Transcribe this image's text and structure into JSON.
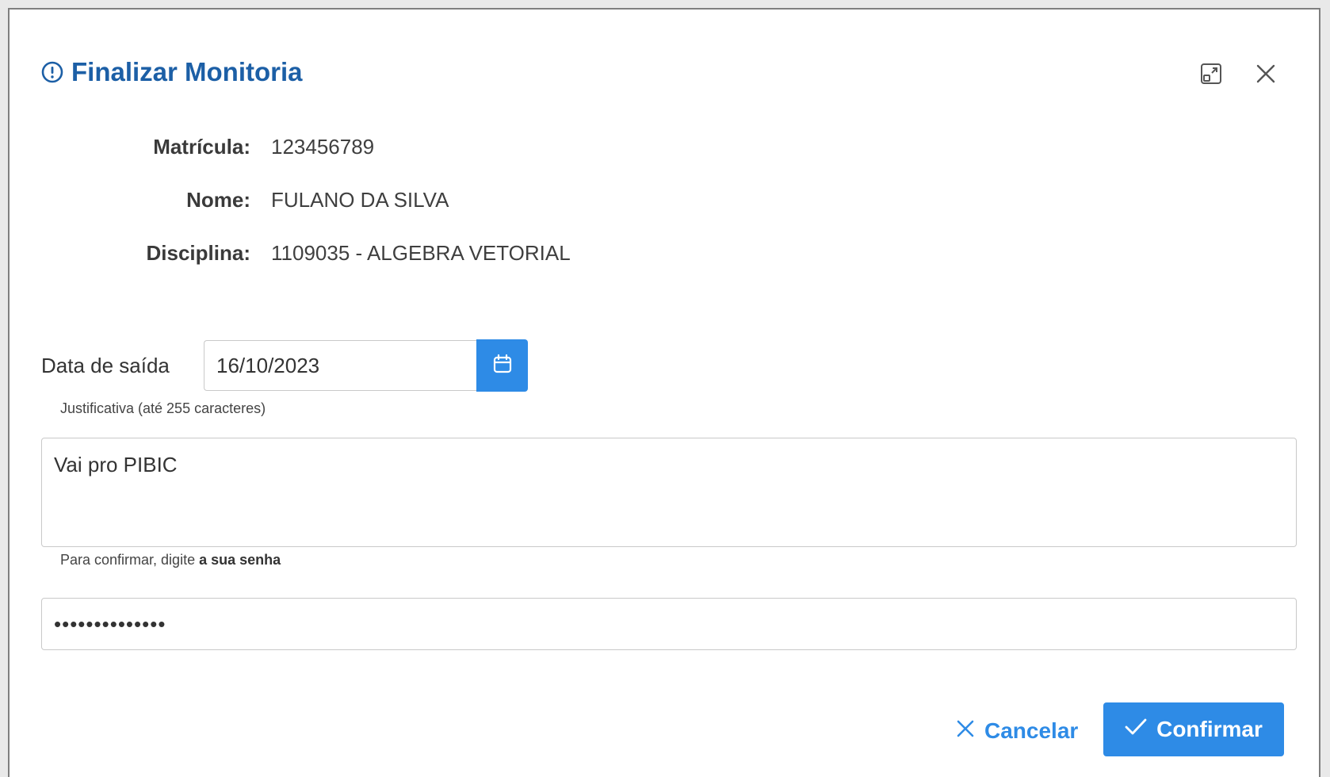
{
  "dialog": {
    "title": "Finalizar Monitoria",
    "title_icon": "exclamation-circle-icon",
    "expand_icon": "window-maximize-icon",
    "close_icon": "close-icon"
  },
  "info": {
    "matricula_label": "Matrícula:",
    "matricula_value": "123456789",
    "nome_label": "Nome:",
    "nome_value": "FULANO DA SILVA",
    "disciplina_label": "Disciplina:",
    "disciplina_value": "1109035 - ALGEBRA VETORIAL"
  },
  "form": {
    "date_label": "Data de saída",
    "date_value": "16/10/2023",
    "calendar_icon": "calendar-icon",
    "justificativa_label": "Justificativa (até 255 caracteres)",
    "justificativa_value": "Vai pro PIBIC",
    "senha_label_prefix": "Para confirmar, digite ",
    "senha_label_bold": "a sua senha",
    "senha_value": "••••••••••••••"
  },
  "actions": {
    "cancel_label": "Cancelar",
    "cancel_icon": "times-icon",
    "confirm_label": "Confirmar",
    "confirm_icon": "check-icon"
  },
  "colors": {
    "title": "#1c5fa6",
    "primary": "#2e8be6"
  }
}
